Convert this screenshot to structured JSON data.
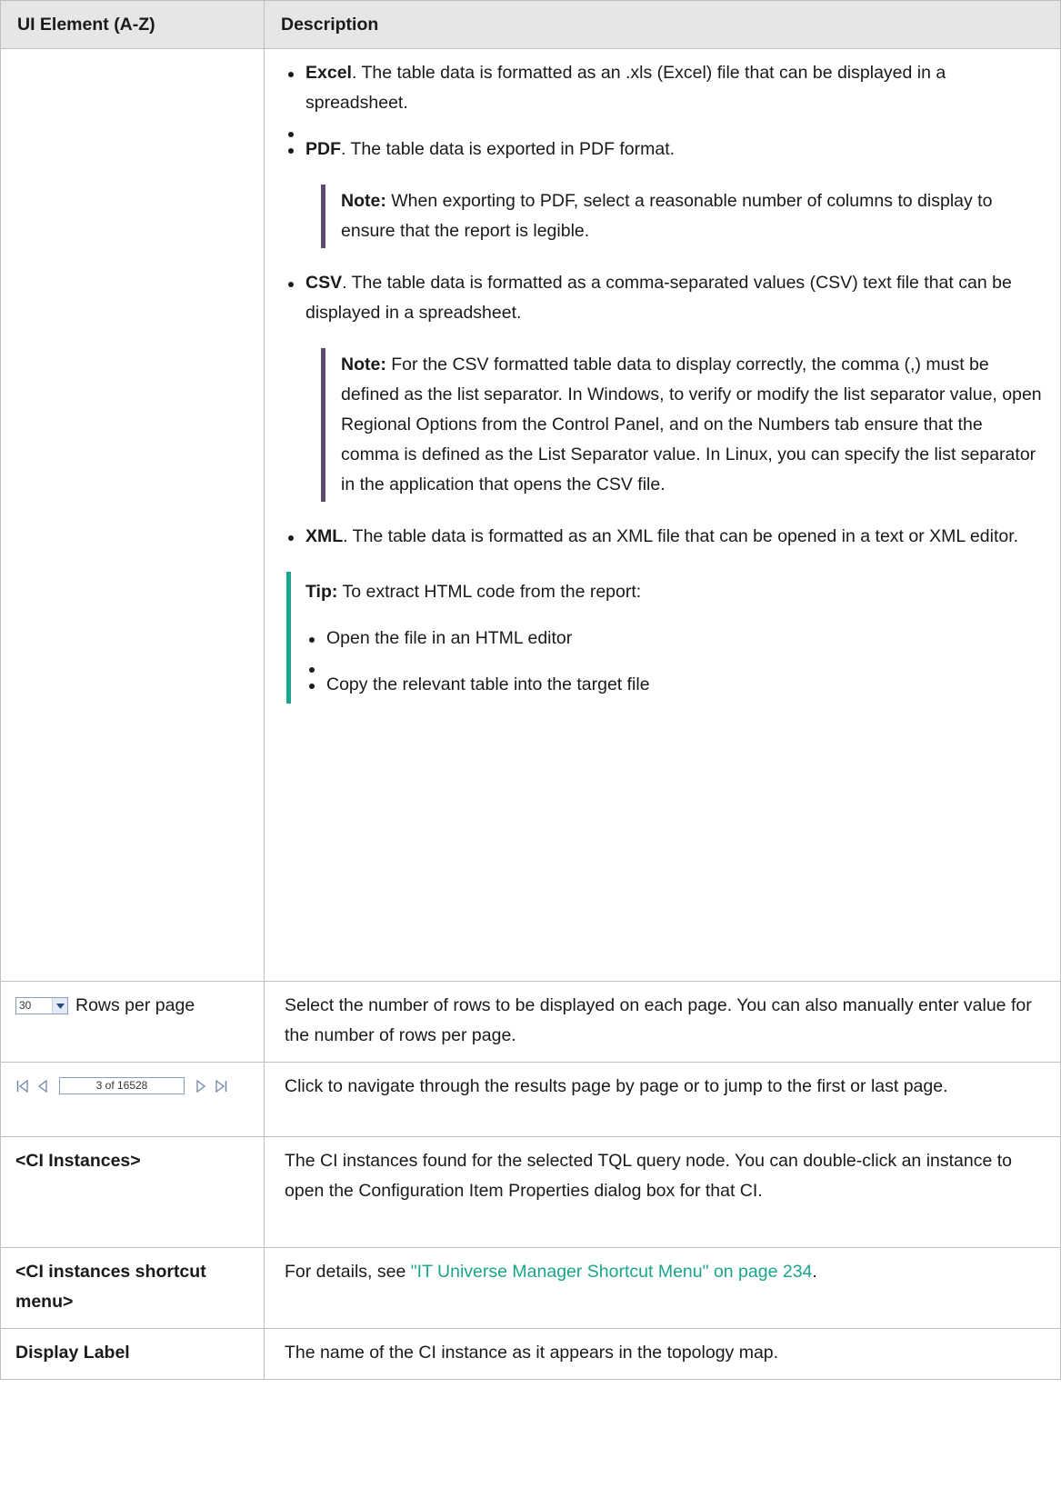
{
  "header": {
    "col1": "UI Element (A-Z)",
    "col2": "Description"
  },
  "export_row": {
    "excel": {
      "name": "Excel",
      "text": ". The table data is formatted as an .xls (Excel) file that can be displayed in a spreadsheet."
    },
    "pdf": {
      "name": "PDF",
      "text": ". The table data is exported in PDF format."
    },
    "pdf_note": {
      "label": "Note:",
      "text": " When exporting to PDF, select a reasonable number of columns to display to ensure that the report is legible."
    },
    "csv": {
      "name": "CSV",
      "text": ". The table data is formatted as a comma-separated values (CSV) text file that can be displayed in a spreadsheet."
    },
    "csv_note": {
      "label": "Note:",
      "text": " For the CSV formatted table data to display correctly, the comma (,) must be defined as the list separator. In Windows, to verify or modify the list separator value, open Regional Options from the Control Panel, and on the Numbers tab ensure that the comma is defined as the List Separator value. In Linux, you can specify the list separator in the application that opens the CSV file."
    },
    "xml": {
      "name": "XML",
      "text": ". The table data is formatted as an XML file that can be opened in a text or XML editor."
    },
    "tip": {
      "label": "Tip:",
      "text": " To extract HTML code from the report:",
      "items": [
        "Open the file in an HTML editor",
        "Copy the relevant table into the target file"
      ]
    }
  },
  "rows_per_page": {
    "select_value": "30",
    "label": "Rows per page",
    "description": "Select the number of rows to be displayed on each page. You can also manually enter value for the number of rows per page."
  },
  "pager": {
    "value": "3 of 16528",
    "description": "Click to navigate through the results page by page or to jump to the first or last page."
  },
  "ci_instances": {
    "label": "<CI Instances>",
    "description": "The CI instances found for the selected TQL query node. You can double-click an instance to open the Configuration Item Properties dialog box for that CI."
  },
  "ci_shortcut": {
    "label": "<CI instances shortcut menu>",
    "prefix": "For details, see ",
    "link": "\"IT Universe Manager Shortcut Menu\" on page 234",
    "suffix": "."
  },
  "display_label": {
    "label": "Display Label",
    "description": "The name of the CI instance as it appears in the topology map."
  },
  "colors": {
    "note_bar": "#5e4b6e",
    "tip_bar": "#1aa58c",
    "link": "#1aa58c",
    "header_bg": "#e6e6e6"
  },
  "icons": [
    "dropdown-arrow-icon",
    "first-page-icon",
    "previous-page-icon",
    "next-page-icon",
    "last-page-icon"
  ]
}
